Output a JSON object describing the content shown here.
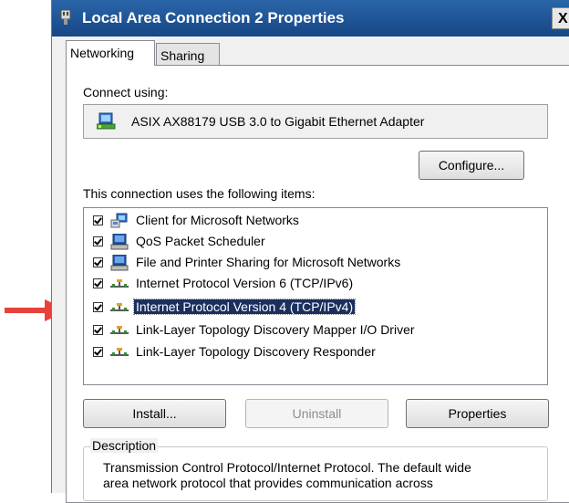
{
  "window": {
    "title": "Local Area Connection 2 Properties",
    "close_label": "X"
  },
  "tabs": [
    {
      "label": "Networking",
      "active": true
    },
    {
      "label": "Sharing",
      "active": false
    }
  ],
  "connect_using": {
    "label": "Connect using:",
    "adapter": "ASIX AX88179 USB 3.0 to Gigabit Ethernet Adapter",
    "configure_label": "Configure..."
  },
  "items_section": {
    "label": "This connection uses the following items:",
    "items": [
      {
        "label": "Client for Microsoft Networks",
        "checked": true,
        "icon": "network-client-icon"
      },
      {
        "label": "QoS Packet Scheduler",
        "checked": true,
        "icon": "computer-service-icon"
      },
      {
        "label": "File and Printer Sharing for Microsoft Networks",
        "checked": true,
        "icon": "computer-service-icon"
      },
      {
        "label": "Internet Protocol Version 6 (TCP/IPv6)",
        "checked": true,
        "icon": "protocol-icon"
      },
      {
        "label": "Internet Protocol Version 4 (TCP/IPv4)",
        "checked": true,
        "icon": "protocol-icon",
        "selected": true
      },
      {
        "label": "Link-Layer Topology Discovery Mapper I/O Driver",
        "checked": true,
        "icon": "protocol-icon"
      },
      {
        "label": "Link-Layer Topology Discovery Responder",
        "checked": true,
        "icon": "protocol-icon"
      }
    ]
  },
  "buttons": {
    "install": "Install...",
    "uninstall": "Uninstall",
    "properties": "Properties"
  },
  "description": {
    "legend": "Description",
    "line1": "Transmission Control Protocol/Internet Protocol. The default wide",
    "line2": "area network protocol that provides communication across"
  },
  "colors": {
    "titlebar": "#1f5496",
    "selection": "#1b2f5f",
    "annotation_arrow": "#e8413b"
  }
}
